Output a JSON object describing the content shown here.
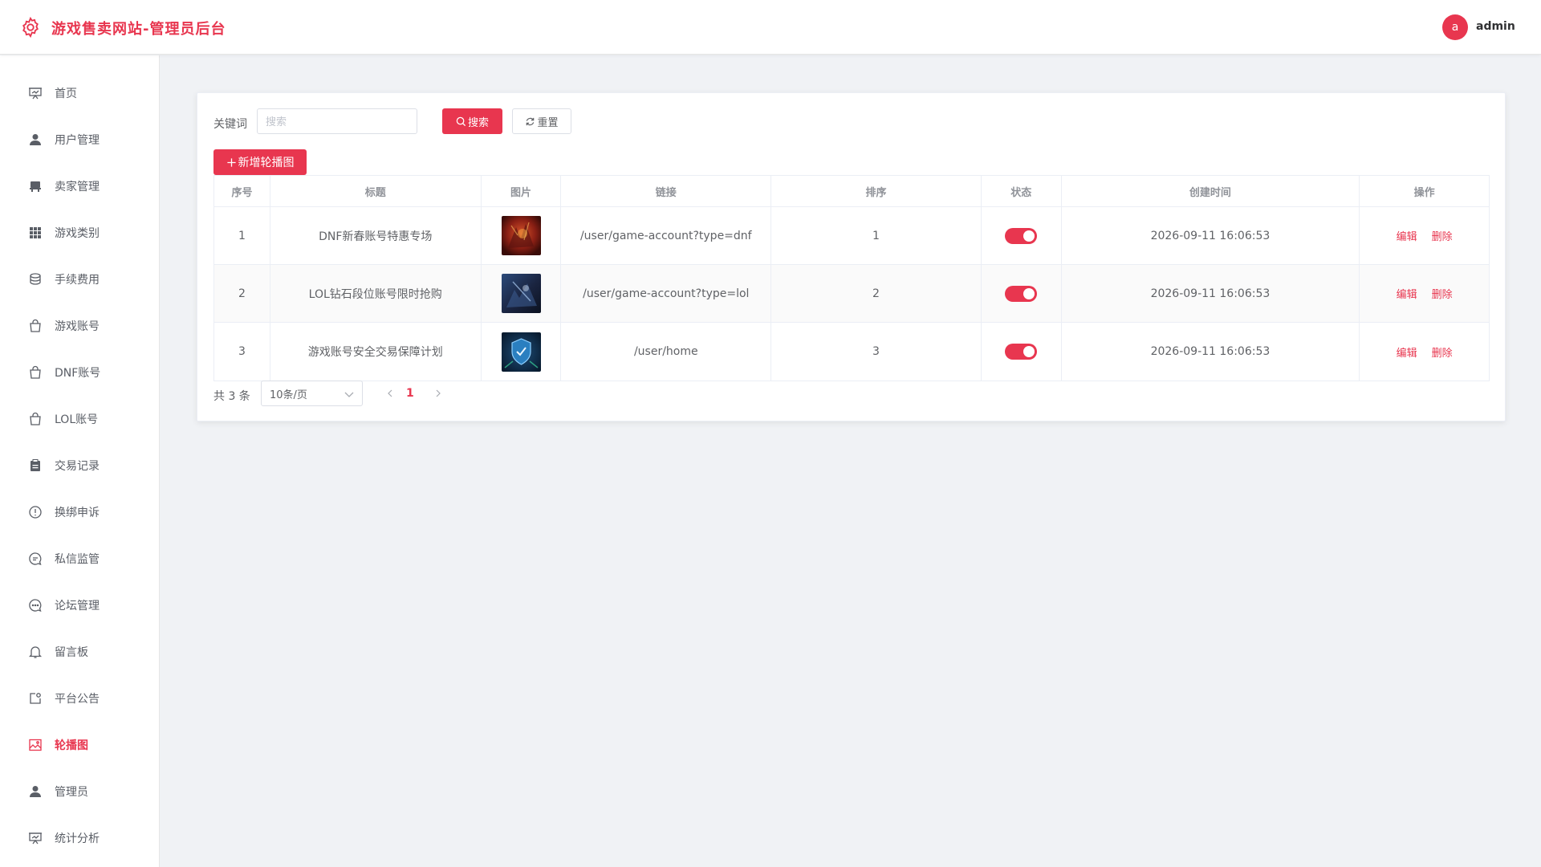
{
  "app": {
    "title": "游戏售卖网站-管理员后台",
    "brand_color": "#e8364f"
  },
  "user": {
    "avatar_letter": "a",
    "name": "admin"
  },
  "sidebar": {
    "active_index": 14,
    "items": [
      {
        "label": "首页",
        "icon": "presentation-icon"
      },
      {
        "label": "用户管理",
        "icon": "user-icon"
      },
      {
        "label": "卖家管理",
        "icon": "chair-icon"
      },
      {
        "label": "游戏类别",
        "icon": "grid-icon"
      },
      {
        "label": "手续费用",
        "icon": "coins-icon"
      },
      {
        "label": "游戏账号",
        "icon": "shopping-bag-icon"
      },
      {
        "label": "DNF账号",
        "icon": "shopping-bag-icon"
      },
      {
        "label": "LOL账号",
        "icon": "shopping-bag-icon"
      },
      {
        "label": "交易记录",
        "icon": "clipboard-icon"
      },
      {
        "label": "换绑申诉",
        "icon": "warning-circle-icon"
      },
      {
        "label": "私信监管",
        "icon": "chat-bubble-icon"
      },
      {
        "label": "论坛管理",
        "icon": "chat-dots-icon"
      },
      {
        "label": "留言板",
        "icon": "bell-icon"
      },
      {
        "label": "平台公告",
        "icon": "notice-icon"
      },
      {
        "label": "轮播图",
        "icon": "picture-icon"
      },
      {
        "label": "管理员",
        "icon": "user-icon"
      },
      {
        "label": "统计分析",
        "icon": "presentation-icon"
      }
    ]
  },
  "filter": {
    "keyword_label": "关键词",
    "keyword_placeholder": "搜索",
    "keyword_value": "",
    "search_label": "搜索",
    "reset_label": "重置",
    "add_label": "新增轮播图"
  },
  "table": {
    "headers": [
      "序号",
      "标题",
      "图片",
      "链接",
      "排序",
      "状态",
      "创建时间",
      "操作"
    ],
    "rows": [
      {
        "index": "1",
        "title": "DNF新春账号特惠专场",
        "image": "dnf-banner-thumbnail",
        "link": "/user/game-account?type=dnf",
        "sort": "1",
        "status": true,
        "created": "2026-09-11 16:06:53",
        "edit": "编辑",
        "delete": "删除"
      },
      {
        "index": "2",
        "title": "LOL钻石段位账号限时抢购",
        "image": "lol-banner-thumbnail",
        "link": "/user/game-account?type=lol",
        "sort": "2",
        "status": true,
        "created": "2026-09-11 16:06:53",
        "edit": "编辑",
        "delete": "删除"
      },
      {
        "index": "3",
        "title": "游戏账号安全交易保障计划",
        "image": "security-shield-thumbnail",
        "link": "/user/home",
        "sort": "3",
        "status": true,
        "created": "2026-09-11 16:06:53",
        "edit": "编辑",
        "delete": "删除"
      }
    ]
  },
  "pagination": {
    "total_text": "共 3 条",
    "page_size": "10条/页",
    "current_page": "1"
  }
}
